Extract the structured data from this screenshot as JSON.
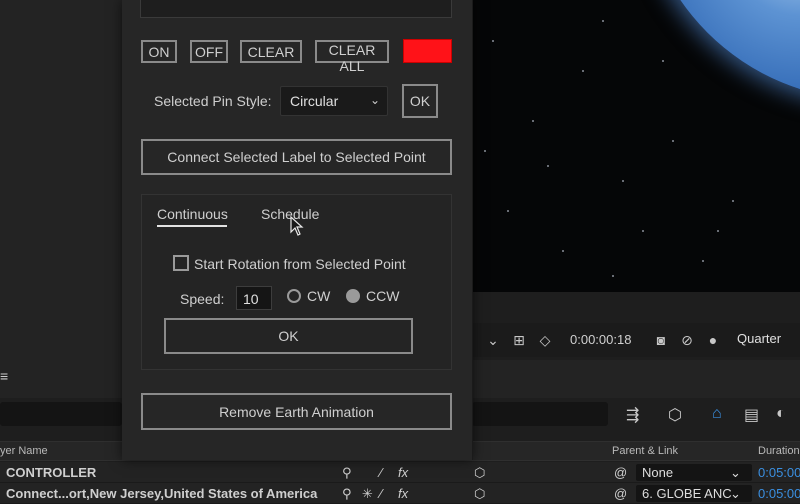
{
  "panel": {
    "buttons": {
      "on": "ON",
      "off": "OFF",
      "clear": "CLEAR",
      "clear_all": "CLEAR ALL"
    },
    "swatch_color": "#ff1218",
    "pin_style": {
      "label": "Selected Pin Style:",
      "value": "Circular",
      "ok": "OK"
    },
    "connect_button": "Connect Selected Label to Selected Point",
    "tabs": [
      {
        "label": "Continuous",
        "active": true
      },
      {
        "label": "Schedule",
        "active": false
      }
    ],
    "rotation_checkbox_label": "Start Rotation from Selected Point",
    "speed_label": "Speed:",
    "speed_value": "10",
    "direction": {
      "cw": "CW",
      "ccw": "CCW",
      "selected": "CCW"
    },
    "ok_button": "OK",
    "remove_button": "Remove Earth Animation"
  },
  "viewer": {
    "timecode": "0:00:00:18",
    "resolution": "Quarter"
  },
  "timeline": {
    "headers": {
      "layer_name": "yer Name",
      "parent_link": "Parent & Link",
      "duration": "Duration"
    },
    "rows": [
      {
        "name": "CONTROLLER",
        "parent": "None",
        "duration": "0:05:00"
      },
      {
        "name": "Connect...ort,New Jersey,United States of America",
        "parent": "6. GLOBE ANC",
        "duration": "0:05:00"
      }
    ]
  }
}
